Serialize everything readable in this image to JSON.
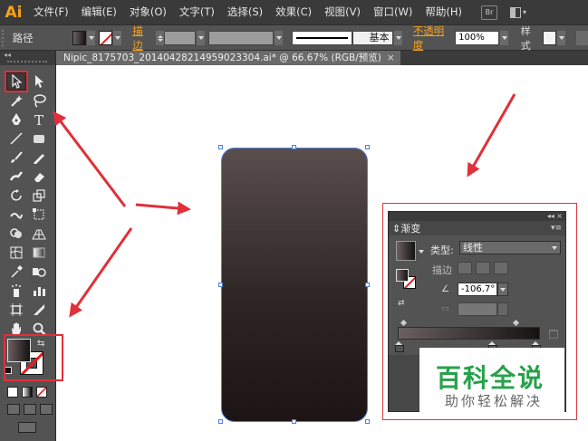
{
  "app": {
    "logo": "Ai",
    "accent": "#f7a21b"
  },
  "menu": [
    "文件(F)",
    "编辑(E)",
    "对象(O)",
    "文字(T)",
    "选择(S)",
    "效果(C)",
    "视图(V)",
    "窗口(W)",
    "帮助(H)"
  ],
  "menu_extras": {
    "bridge_label": "Br",
    "layout_icon": "workspace-layout-icon"
  },
  "control_bar": {
    "object_type": "路径",
    "stroke_label": "描边",
    "stroke_profile": "基本",
    "opacity_label": "不透明度",
    "opacity_value": "100%",
    "style_label": "样式"
  },
  "document_tab": {
    "title": "Nipic_8175703_20140428214959023304.ai*  @  66.67% (RGB/预览)",
    "close": "×"
  },
  "toolbar": {
    "tools": [
      "selection-tool",
      "direct-selection-tool",
      "magic-wand-tool",
      "lasso-tool",
      "pen-tool",
      "type-tool",
      "line-tool",
      "rectangle-tool",
      "paintbrush-tool",
      "pencil-tool",
      "blob-brush-tool",
      "eraser-tool",
      "rotate-tool",
      "scale-tool",
      "warp-tool",
      "free-transform-tool",
      "shape-builder-tool",
      "perspective-grid-tool",
      "mesh-tool",
      "gradient-tool",
      "eyedropper-tool",
      "blend-tool",
      "symbol-sprayer-tool",
      "column-graph-tool",
      "artboard-tool",
      "slice-tool",
      "hand-tool",
      "zoom-tool"
    ],
    "swap_glyph": "⇆"
  },
  "gradient_panel": {
    "tab_label": "渐变",
    "collapse_glyph": "◂◂",
    "close_glyph": "×",
    "menu_glyph": "▾≡",
    "type_label": "类型:",
    "type_value": "线性",
    "stroke_label": "描边",
    "angle_value": "-106.7°",
    "stop_start_color": "#6b6060",
    "stop_end_color": "#151212"
  },
  "watermark": {
    "title": "百科全说",
    "subtitle": "助你轻松解决",
    "title_color": "#27a14a"
  },
  "annotation_color": "#e0303a"
}
